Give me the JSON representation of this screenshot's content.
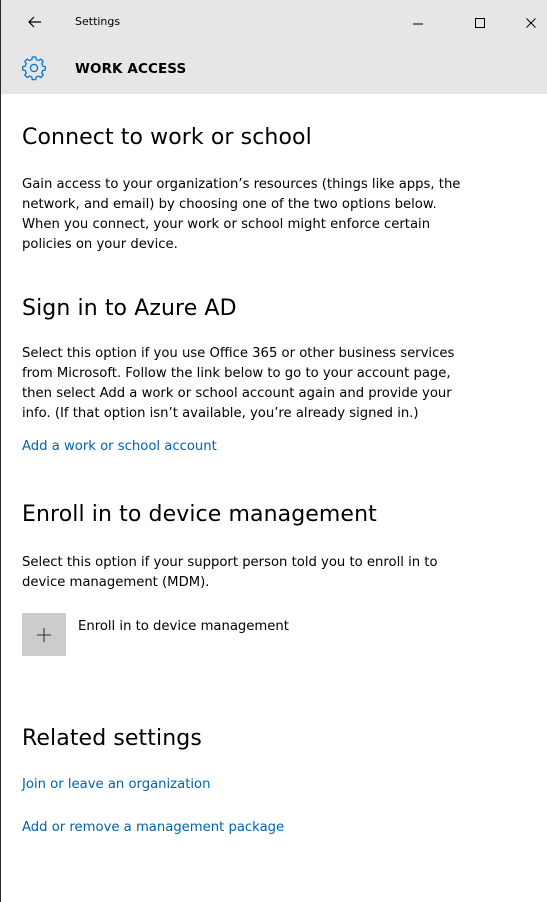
{
  "window": {
    "app_title": "Settings",
    "minimize_glyph": "–",
    "maximize_glyph": "☐",
    "close_glyph": "✕",
    "back_glyph": "←"
  },
  "header": {
    "icon": "gear-icon",
    "title": "WORK ACCESS"
  },
  "connect": {
    "heading": "Connect to work or school",
    "lines": [
      "Gain access to your organization’s resources (things like apps, the",
      "network, and email) by choosing one of the two options below.",
      "When you connect, your work or school might enforce certain",
      "policies on your device."
    ]
  },
  "azure": {
    "heading": "Sign in to Azure AD",
    "lines": [
      "Select this option if you use Office 365 or other business services",
      "from Microsoft. Follow the link below to go to your account page,",
      "then select Add a work or school account again and provide your",
      "info. (If that option isn’t available, you’re already signed in.)"
    ],
    "link": "Add a work or school account"
  },
  "enroll": {
    "heading": "Enroll in to device management",
    "lines": [
      "Select this option if your support person told you to enroll in to",
      "device management (MDM)."
    ],
    "button_label": "Enroll in to device management",
    "button_icon": "plus-icon"
  },
  "related": {
    "heading": "Related settings",
    "links": [
      "Join or leave an organization",
      "Add or remove a management package"
    ]
  },
  "colors": {
    "title_bar": "#e6e6e6",
    "link": "#0063b1",
    "accent": "#0078d7",
    "tile": "#cccccc"
  }
}
